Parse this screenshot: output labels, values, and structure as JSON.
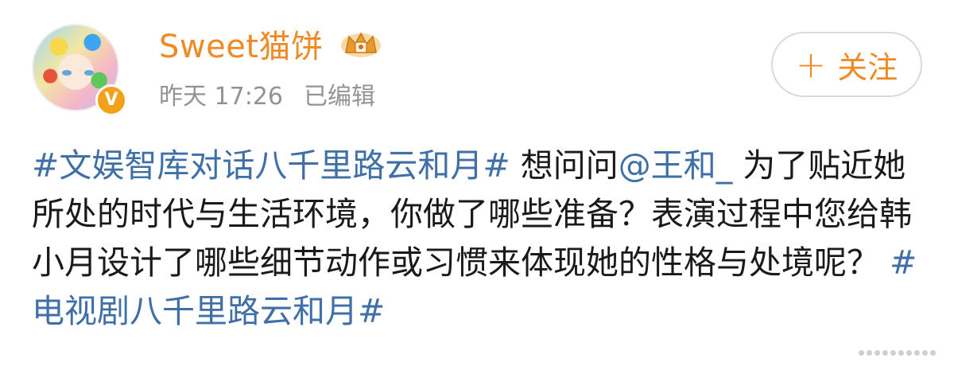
{
  "author": {
    "name": "Sweet猫饼",
    "badge_icon": "crown-icon",
    "verified_icon": "verified-v-icon"
  },
  "meta": {
    "time": "昨天 17:26",
    "edited": "已编辑"
  },
  "follow": {
    "plus": "+",
    "label": "关注"
  },
  "post": {
    "topic1": "#文娱智库对话八千里路云和月#",
    "text1": " 想问问",
    "mention": "@王和_",
    "text2": " 为了贴近她所处的时代与生活环境，你做了哪些准备？表演过程中您给韩小月设计了哪些细节动作或习惯来体现她的性格与处境呢？",
    "topic2": "#电视剧八千里路云和月#"
  },
  "colors": {
    "accent": "#f08a24",
    "link": "#3f6fa7",
    "meta": "#939393",
    "badge": "#f3a01b"
  }
}
